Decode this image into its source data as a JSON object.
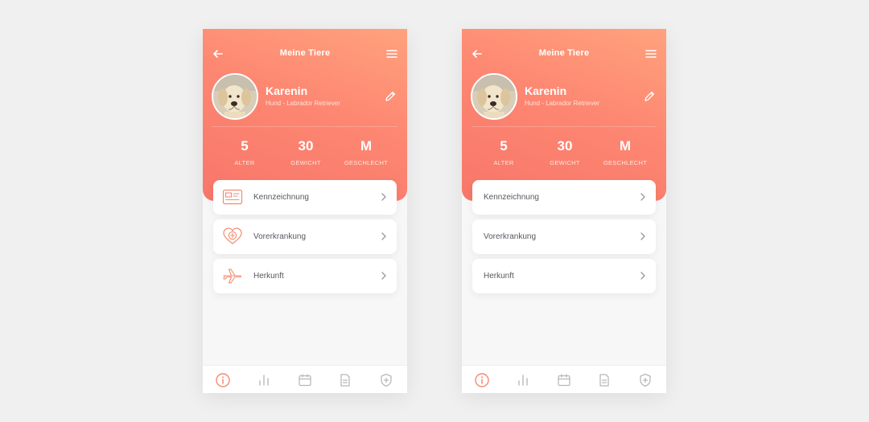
{
  "screens": [
    {
      "title": "Meine Tiere",
      "pet": {
        "name": "Karenin",
        "breed": "Hund - Labrador Retriever"
      },
      "stats": [
        {
          "value": "5",
          "label": "ALTER"
        },
        {
          "value": "30",
          "label": "GEWICHT"
        },
        {
          "value": "M",
          "label": "GESCHLECHT"
        }
      ],
      "cards": [
        {
          "label": "Kennzeichnung",
          "icon": "id-card-icon"
        },
        {
          "label": "Vorerkrankung",
          "icon": "heart-plus-icon"
        },
        {
          "label": "Herkunft",
          "icon": "airplane-icon"
        }
      ]
    },
    {
      "title": "Meine Tiere",
      "pet": {
        "name": "Karenin",
        "breed": "Hund - Labrador Retriever"
      },
      "stats": [
        {
          "value": "5",
          "label": "ALTER"
        },
        {
          "value": "30",
          "label": "GEWICHT"
        },
        {
          "value": "M",
          "label": "GESCHLECHT"
        }
      ],
      "cards": [
        {
          "label": "Kennzeichnung"
        },
        {
          "label": "Vorerkrankung"
        },
        {
          "label": "Herkunft"
        }
      ]
    }
  ],
  "tabs": [
    "info-icon",
    "bar-chart-icon",
    "calendar-icon",
    "document-icon",
    "shield-plus-icon"
  ],
  "colors": {
    "accent": "#f8766a",
    "accent_light": "#ffa27d",
    "background": "#f0f0f1",
    "card": "#ffffff",
    "icon_inactive": "#b8b8bd"
  }
}
